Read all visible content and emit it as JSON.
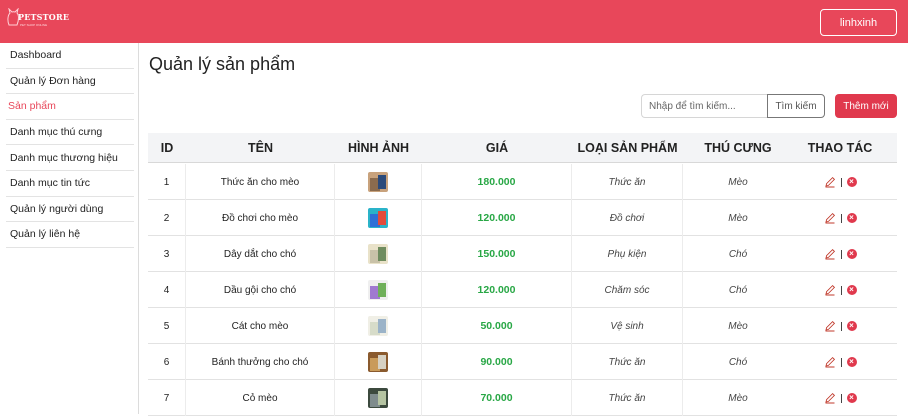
{
  "header": {
    "logo_text": "PETSTORE",
    "logo_sub": "PET SHOP ONLINE",
    "user_label": "linhxinh"
  },
  "sidebar": {
    "items": [
      {
        "label": "Dashboard"
      },
      {
        "label": "Quản lý Đơn hàng"
      },
      {
        "label": "Sản phẩm"
      },
      {
        "label": "Danh mục thú cưng"
      },
      {
        "label": "Danh mục thương hiệu"
      },
      {
        "label": "Danh mục tin tức"
      },
      {
        "label": "Quản lý người dùng"
      },
      {
        "label": "Quản lý liên hệ"
      }
    ],
    "active_index": 2
  },
  "main": {
    "title": "Quản lý sản phẩm",
    "search_placeholder": "Nhập để tìm kiếm...",
    "search_button": "Tìm kiếm",
    "add_button": "Thêm mới"
  },
  "table": {
    "columns": [
      "ID",
      "TÊN",
      "HÌNH ẢNH",
      "GIÁ",
      "LOẠI SẢN PHẨM",
      "THÚ CƯNG",
      "THAO TÁC"
    ],
    "rows": [
      {
        "id": "1",
        "name": "Thức ăn cho mèo",
        "price": "180.000",
        "type": "Thức ăn",
        "pet": "Mèo"
      },
      {
        "id": "2",
        "name": "Đồ chơi cho mèo",
        "price": "120.000",
        "type": "Đồ chơi",
        "pet": "Mèo"
      },
      {
        "id": "3",
        "name": "Dây dắt cho chó",
        "price": "150.000",
        "type": "Phụ kiện",
        "pet": "Chó"
      },
      {
        "id": "4",
        "name": "Dầu gội cho chó",
        "price": "120.000",
        "type": "Chăm sóc",
        "pet": "Chó"
      },
      {
        "id": "5",
        "name": "Cát cho mèo",
        "price": "50.000",
        "type": "Vệ sinh",
        "pet": "Mèo"
      },
      {
        "id": "6",
        "name": "Bánh thưởng cho chó",
        "price": "90.000",
        "type": "Thức ăn",
        "pet": "Chó"
      },
      {
        "id": "7",
        "name": "Cỏ mèo",
        "price": "70.000",
        "type": "Thức ăn",
        "pet": "Mèo"
      }
    ]
  },
  "colors": {
    "brand": "#e8475a",
    "price": "#28a745",
    "delete": "#e0394d"
  }
}
